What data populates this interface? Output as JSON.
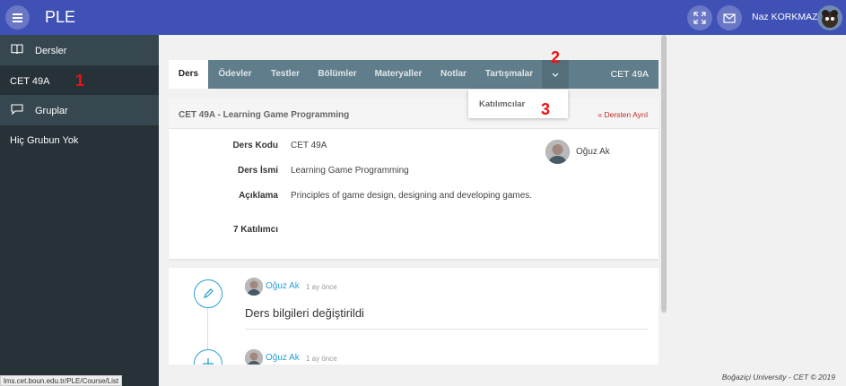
{
  "app": {
    "title": "PLE"
  },
  "header": {
    "user_name": "Naz KORKMAZ"
  },
  "sidebar": {
    "courses_label": "Dersler",
    "course_item": "CET 49A",
    "groups_label": "Gruplar",
    "no_group": "Hiç Grubun Yok"
  },
  "markers": {
    "m1": "1",
    "m2": "2",
    "m3": "3"
  },
  "tabs": [
    "Ders",
    "Ödevler",
    "Testler",
    "Bölümler",
    "Materyaller",
    "Notlar",
    "Tartışmalar"
  ],
  "course_code_tab": "CET 49A",
  "dropdown": {
    "item": "Katılımcılar"
  },
  "course": {
    "header_title": "CET 49A - Learning Game Programming",
    "leave_label": "Dersten Ayrıl",
    "code_label": "Ders Kodu",
    "code_value": "CET 49A",
    "name_label": "Ders İsmi",
    "name_value": "Learning Game Programming",
    "desc_label": "Açıklama",
    "desc_value": "Principles of game design, designing and developing games.",
    "participants": "7 Katılımcı",
    "teacher_name": "Oğuz Ak"
  },
  "feed": [
    {
      "author": "Oğuz Ak",
      "time": "1 ay önce",
      "message": "Ders bilgileri değiştirildi"
    },
    {
      "author": "Oğuz Ak",
      "time": "1 ay önce"
    }
  ],
  "status_url": "lms.cet.boun.edu.tr/PLE/Course/List",
  "footer": "Boğaziçi University - CET © 2019",
  "colors": {
    "topbar": "#3f51b5",
    "sidebar": "#263238",
    "tabs": "#607d8b",
    "accent": "#29a0d6",
    "marker": "#e11111"
  }
}
